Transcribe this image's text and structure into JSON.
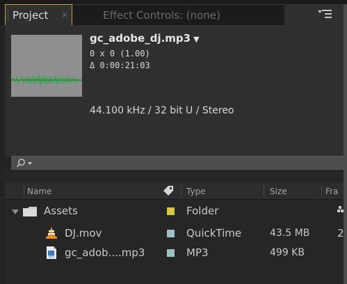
{
  "tabs": {
    "project_label": "Project",
    "project_close": "×",
    "effect_controls_label": "Effect Controls: (none)"
  },
  "preview": {
    "file_name": "gc_adobe_dj.mp3",
    "file_caret": "▼",
    "dimensions": "0 x 0 (1.00)",
    "duration": "Δ 0:00:21:03",
    "audio_info": "44.100 kHz / 32 bit U / Stereo"
  },
  "search": {
    "value": "",
    "placeholder": ""
  },
  "columns": {
    "name": "Name",
    "label_icon": "tag-icon",
    "type": "Type",
    "size": "Size",
    "frame_rate": "Fra"
  },
  "items": [
    {
      "name": "Assets",
      "icon": "folder-icon",
      "label_color": "#d8c840",
      "type": "Folder",
      "size": "",
      "expanded": true
    },
    {
      "name": "DJ.mov",
      "icon": "vlc-icon",
      "label_color": "#9cc3c0",
      "type": "QuickTime",
      "size": "43.5 MB",
      "frame_rate": "2"
    },
    {
      "name": "gc_adob....mp3",
      "icon": "mp3-icon",
      "label_color": "#9cc3c0",
      "type": "MP3",
      "size": "499 KB"
    }
  ],
  "colors": {
    "active_tab_border": "#c7a43a",
    "panel_bg": "#2f2f2f",
    "list_bg": "#262626"
  }
}
